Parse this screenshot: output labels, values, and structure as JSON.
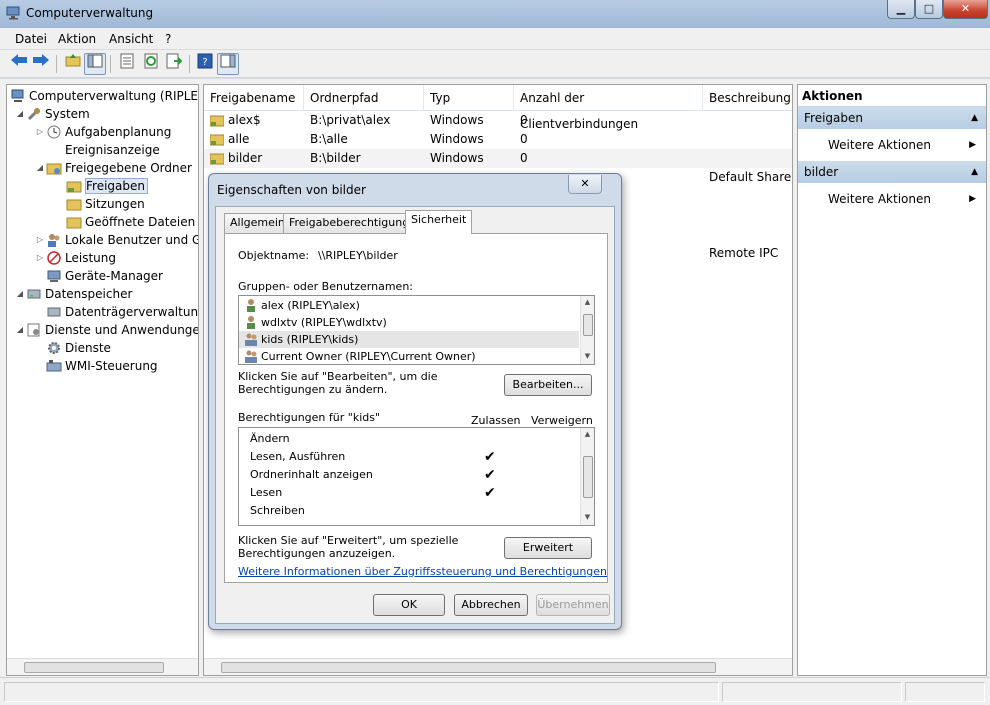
{
  "window": {
    "title": "Computerverwaltung",
    "controls": {
      "minimize": "▁",
      "maximize": "□",
      "close": "✕"
    }
  },
  "menu": [
    "Datei",
    "Aktion",
    "Ansicht",
    "?"
  ],
  "tree": {
    "items": [
      {
        "label": "Computerverwaltung (RIPLEY)",
        "icon": "computer-management-icon"
      },
      {
        "label": "System",
        "icon": "tools-icon"
      },
      {
        "label": "Aufgabenplanung",
        "icon": "clock-icon"
      },
      {
        "label": "Ereignisanzeige",
        "icon": "event-viewer-icon"
      },
      {
        "label": "Freigegebene Ordner",
        "icon": "shared-folder-icon"
      },
      {
        "label": "Freigaben",
        "icon": "share-icon"
      },
      {
        "label": "Sitzungen",
        "icon": "sessions-icon"
      },
      {
        "label": "Geöffnete Dateien",
        "icon": "open-files-icon"
      },
      {
        "label": "Lokale Benutzer und Gr",
        "icon": "users-icon"
      },
      {
        "label": "Leistung",
        "icon": "performance-icon"
      },
      {
        "label": "Geräte-Manager",
        "icon": "device-manager-icon"
      },
      {
        "label": "Datenspeicher",
        "icon": "storage-icon"
      },
      {
        "label": "Datenträgerverwaltung",
        "icon": "disk-icon"
      },
      {
        "label": "Dienste und Anwendungen",
        "icon": "services-apps-icon"
      },
      {
        "label": "Dienste",
        "icon": "gear-icon"
      },
      {
        "label": "WMI-Steuerung",
        "icon": "wmi-icon"
      }
    ]
  },
  "list": {
    "columns": [
      "Freigabename",
      "Ordnerpfad",
      "Typ",
      "Anzahl der Clientverbindungen",
      "Beschreibung"
    ],
    "rows": [
      {
        "name": "alex$",
        "path": "B:\\privat\\alex",
        "type": "Windows",
        "count": "0",
        "desc": ""
      },
      {
        "name": "alle",
        "path": "B:\\alle",
        "type": "Windows",
        "count": "0",
        "desc": ""
      },
      {
        "name": "bilder",
        "path": "B:\\bilder",
        "type": "Windows",
        "count": "0",
        "desc": ""
      }
    ],
    "partial_descriptions": [
      "Default Share",
      "Remote IPC"
    ]
  },
  "actions": {
    "header": "Aktionen",
    "sections": [
      {
        "title": "Freigaben",
        "item": "Weitere Aktionen"
      },
      {
        "title": "bilder",
        "item": "Weitere Aktionen"
      }
    ]
  },
  "dialog": {
    "title": "Eigenschaften von bilder",
    "close": "✕",
    "tabs": [
      "Allgemein",
      "Freigabeberechtigungen",
      "Sicherheit"
    ],
    "object_label": "Objektname:",
    "object_value": "\\\\RIPLEY\\bilder",
    "groups_label": "Gruppen- oder Benutzernamen:",
    "users": [
      "alex (RIPLEY\\alex)",
      "wdlxtv (RIPLEY\\wdlxtv)",
      "kids (RIPLEY\\kids)",
      "Current Owner (RIPLEY\\Current Owner)"
    ],
    "edit_hint": "Klicken Sie auf \"Bearbeiten\", um die Berechtigungen zu ändern.",
    "edit_button": "Bearbeiten...",
    "perm_label": "Berechtigungen für \"kids\"",
    "allow_header": "Zulassen",
    "deny_header": "Verweigern",
    "permissions": [
      {
        "name": "Ändern",
        "allow": ""
      },
      {
        "name": "Lesen, Ausführen",
        "allow": "✔"
      },
      {
        "name": "Ordnerinhalt anzeigen",
        "allow": "✔"
      },
      {
        "name": "Lesen",
        "allow": "✔"
      },
      {
        "name": "Schreiben",
        "allow": ""
      }
    ],
    "advanced_hint": "Klicken Sie auf \"Erweitert\", um spezielle Berechtigungen anzuzeigen.",
    "advanced_button": "Erweitert",
    "info_link": "Weitere Informationen über Zugriffssteuerung und Berechtigungen",
    "ok": "OK",
    "cancel": "Abbrechen",
    "apply": "Übernehmen"
  }
}
